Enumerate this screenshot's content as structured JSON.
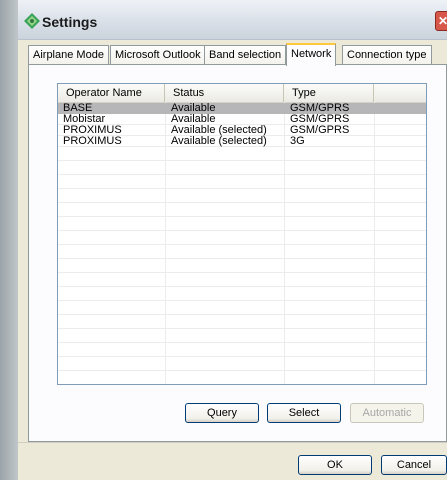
{
  "window": {
    "title": "Settings",
    "title_icon": "diamond-gear-icon",
    "close_glyph": "✕"
  },
  "tabs": [
    {
      "label": "Airplane Mode"
    },
    {
      "label": "Microsoft Outlook"
    },
    {
      "label": "Band selection"
    },
    {
      "label": "Network",
      "active": true
    },
    {
      "label": "Connection type"
    }
  ],
  "table": {
    "headers": [
      "Operator Name",
      "Status",
      "Type"
    ],
    "rows": [
      {
        "name": "BASE",
        "status": "Available",
        "type": "GSM/GPRS",
        "selected": true
      },
      {
        "name": "Mobistar",
        "status": "Available",
        "type": "GSM/GPRS"
      },
      {
        "name": "PROXIMUS",
        "status": "Available (selected)",
        "type": "GSM/GPRS"
      },
      {
        "name": "PROXIMUS",
        "status": "Available (selected)",
        "type": "3G"
      }
    ]
  },
  "buttons": {
    "query": "Query",
    "select": "Select",
    "automatic": "Automatic",
    "ok": "OK",
    "cancel": "Cancel"
  },
  "colors": {
    "selection": "#b6b6b9",
    "tab_active_accent": "#ffc83c"
  }
}
